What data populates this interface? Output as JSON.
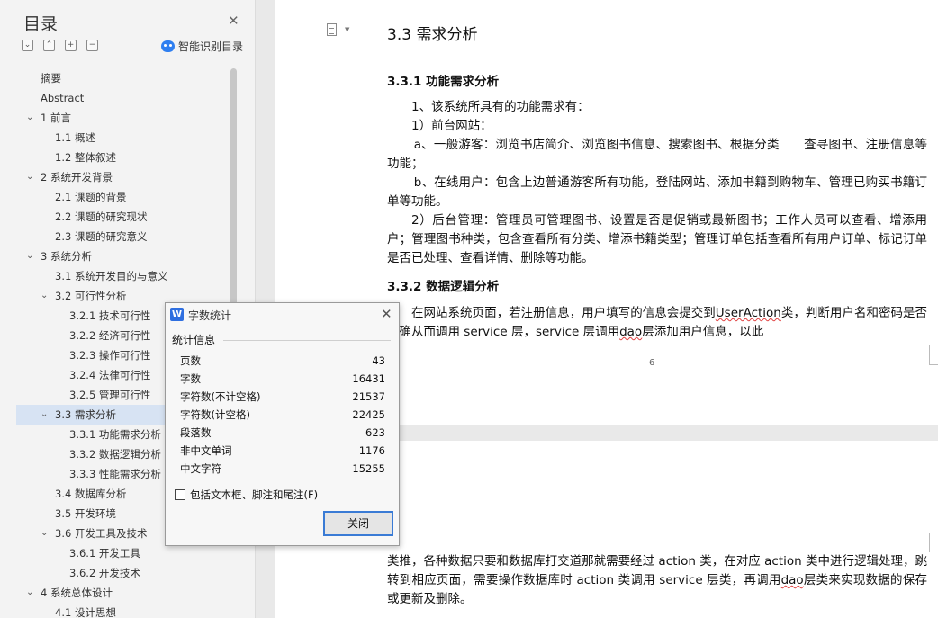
{
  "toc": {
    "title": "目录",
    "smart_label": "智能识别目录",
    "tool_icons": [
      "collapse-icon",
      "expand-icon",
      "plus-icon",
      "minus-icon"
    ],
    "items": [
      {
        "label": "摘要",
        "level": 0,
        "arrow": ""
      },
      {
        "label": "Abstract",
        "level": 0,
        "arrow": ""
      },
      {
        "label": "1 前言",
        "level": 0,
        "arrow": "v"
      },
      {
        "label": "1.1 概述",
        "level": 1,
        "arrow": ""
      },
      {
        "label": "1.2 整体叙述",
        "level": 1,
        "arrow": ""
      },
      {
        "label": "2 系统开发背景",
        "level": 0,
        "arrow": "v"
      },
      {
        "label": "2.1 课题的背景",
        "level": 1,
        "arrow": ""
      },
      {
        "label": "2.2 课题的研究现状",
        "level": 1,
        "arrow": ""
      },
      {
        "label": "2.3 课题的研究意义",
        "level": 1,
        "arrow": ""
      },
      {
        "label": "3 系统分析",
        "level": 0,
        "arrow": "v"
      },
      {
        "label": "3.1 系统开发目的与意义",
        "level": 1,
        "arrow": ""
      },
      {
        "label": "3.2 可行性分析",
        "level": 1,
        "arrow": "v"
      },
      {
        "label": "3.2.1 技术可行性",
        "level": 2,
        "arrow": ""
      },
      {
        "label": "3.2.2 经济可行性",
        "level": 2,
        "arrow": ""
      },
      {
        "label": "3.2.3 操作可行性",
        "level": 2,
        "arrow": ""
      },
      {
        "label": "3.2.4 法律可行性",
        "level": 2,
        "arrow": ""
      },
      {
        "label": "3.2.5 管理可行性",
        "level": 2,
        "arrow": ""
      },
      {
        "label": "3.3 需求分析",
        "level": 1,
        "arrow": "v",
        "active": true
      },
      {
        "label": "3.3.1 功能需求分析",
        "level": 2,
        "arrow": ""
      },
      {
        "label": "3.3.2 数据逻辑分析",
        "level": 2,
        "arrow": ""
      },
      {
        "label": "3.3.3 性能需求分析",
        "level": 2,
        "arrow": ""
      },
      {
        "label": "3.4 数据库分析",
        "level": 1,
        "arrow": ""
      },
      {
        "label": "3.5 开发环境",
        "level": 1,
        "arrow": ""
      },
      {
        "label": "3.6 开发工具及技术",
        "level": 1,
        "arrow": "v"
      },
      {
        "label": "3.6.1 开发工具",
        "level": 2,
        "arrow": ""
      },
      {
        "label": "3.6.2 开发技术",
        "level": 2,
        "arrow": ""
      },
      {
        "label": "4 系统总体设计",
        "level": 0,
        "arrow": "v"
      },
      {
        "label": "4.1 设计思想",
        "level": 1,
        "arrow": ""
      }
    ]
  },
  "document": {
    "h2": "3.3 需求分析",
    "h3_1": "3.3.1 功能需求分析",
    "p1": "1、该系统所具有的功能需求有：",
    "p2": "1）前台网站：",
    "p3": "a、一般游客：浏览书店简介、浏览图书信息、搜索图书、根据分类　　查寻图书、注册信息等功能；",
    "p4": "b、在线用户：包含上边普通游客所有功能，登陆网站、添加书籍到购物车、管理已购买书籍订单等功能。",
    "p5": "2）后台管理：管理员可管理图书、设置是否是促销或最新图书；工作人员可以查看、增添用户；管理图书种类，包含查看所有分类、增添书籍类型；管理订单包括查看所有用户订单、标记订单是否已处理、查看详情、删除等功能。",
    "h3_2": "3.3.2 数据逻辑分析",
    "p6_a": "在网站系统页面，若注册信息，用户填写的信息会提交到",
    "p6_w1": "UserAction",
    "p6_b": "类，判断用户名和密码是否正确从而调用 service 层，service 层调用",
    "p6_w2": "dao",
    "p6_c": "层添加用户信息，以此",
    "page_number": "6",
    "p7_a": "类推，各种数据只要和数据库打交道那就需要经过 action 类，在对应 action 类中进行逻辑处理，跳转到相应页面，需要操作数据库时 action 类调用 service 层类，再调用",
    "p7_w": "dao",
    "p7_b": "层类来实现数据的保存或更新及删除。"
  },
  "dialog": {
    "title": "字数统计",
    "group_label": "统计信息",
    "stats": [
      {
        "label": "页数",
        "value": "43"
      },
      {
        "label": "字数",
        "value": "16431"
      },
      {
        "label": "字符数(不计空格)",
        "value": "21537"
      },
      {
        "label": "字符数(计空格)",
        "value": "22425"
      },
      {
        "label": "段落数",
        "value": "623"
      },
      {
        "label": "非中文单词",
        "value": "1176"
      },
      {
        "label": "中文字符",
        "value": "15255"
      }
    ],
    "checkbox_label": "包括文本框、脚注和尾注(F)",
    "checkbox_checked": false,
    "close_button": "关闭"
  },
  "colors": {
    "accent": "#2f6fe0",
    "active_toc": "#d7e3f3",
    "spell_error": "#e04040"
  }
}
